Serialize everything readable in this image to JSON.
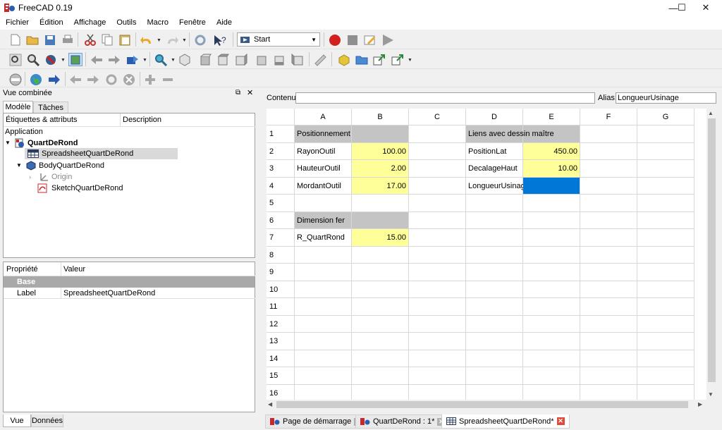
{
  "window": {
    "title": "FreeCAD 0.19",
    "minimize": "—",
    "maximize": "☐",
    "close": "✕"
  },
  "menu": [
    "Fichier",
    "Édition",
    "Affichage",
    "Outils",
    "Macro",
    "Fenêtre",
    "Aide"
  ],
  "toolbar": {
    "macro_select": "Start"
  },
  "combo": {
    "title": "Vue combinée",
    "tab_model": "Modèle",
    "tab_tasks": "Tâches",
    "tree_header_labels": "Étiquettes & attributs",
    "tree_header_description": "Description",
    "tree": [
      {
        "label": "Application"
      },
      {
        "label": "QuartDeRond"
      },
      {
        "label": "SpreadsheetQuartDeRond"
      },
      {
        "label": "BodyQuartDeRond"
      },
      {
        "label": "Origin"
      },
      {
        "label": "SketchQuartDeRond"
      }
    ],
    "prop_header_property": "Propriété",
    "prop_header_value": "Valeur",
    "prop_group": "Base",
    "prop_rows": [
      {
        "name": "Label",
        "value": "SpreadsheetQuartDeRond"
      }
    ],
    "bottom_tab_view": "Vue",
    "bottom_tab_data": "Données"
  },
  "spreadsheet": {
    "content_label": "Contenu:",
    "content_value": "",
    "alias_label": "Alias:",
    "alias_value": "LongueurUsinage",
    "columns": [
      "A",
      "B",
      "C",
      "D",
      "E",
      "F",
      "G"
    ],
    "rows": [
      "1",
      "2",
      "3",
      "4",
      "5",
      "6",
      "7",
      "8",
      "9",
      "10",
      "11",
      "12",
      "13",
      "14",
      "15",
      "16"
    ],
    "cells": {
      "A1": "Positionnement",
      "A2": "RayonOutil",
      "B2": "100.00",
      "A3": "HauteurOutil",
      "B3": "2.00",
      "A4": "MordantOutil",
      "B4": "17.00",
      "A6": "Dimension fer",
      "A7": "R_QuartRond",
      "B7": "15.00",
      "D1": "Liens avec dessin maître",
      "D2": "PositionLat",
      "E2": "450.00",
      "D3": "DecalageHaut",
      "E3": "10.00",
      "D4": "LongueurUsinage",
      "E4": ""
    }
  },
  "doc_tabs": [
    {
      "label": "Page de démarrage"
    },
    {
      "label": "QuartDeRond : 1*"
    },
    {
      "label": "SpreadsheetQuartDeRond*"
    }
  ],
  "colors": {
    "header_gray": "#c4c4c4",
    "alias_yellow": "#ffff99",
    "selection_blue": "#0078d7",
    "record_red": "#d21f1f",
    "group_gray": "#a9a9a9"
  }
}
